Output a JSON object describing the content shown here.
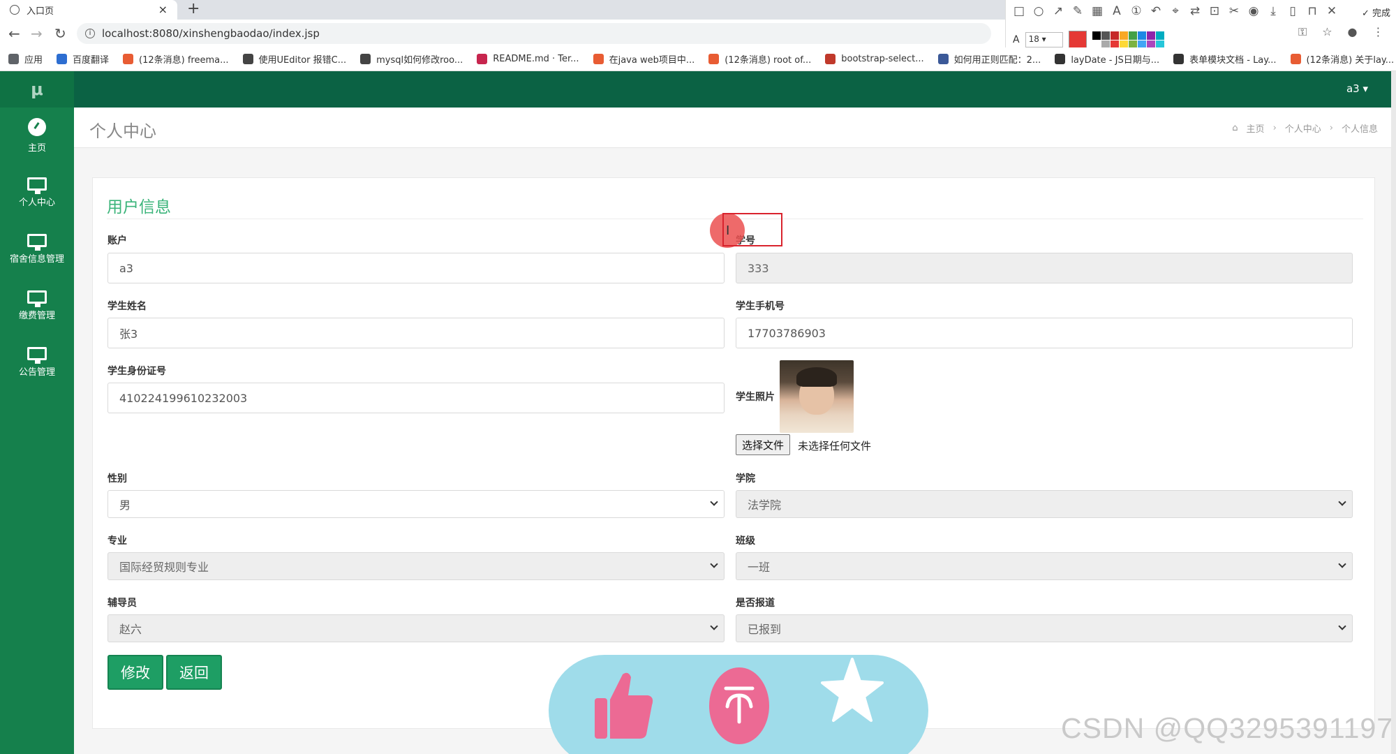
{
  "browser": {
    "tab_title": "入口页",
    "tab_close": "×",
    "new_tab": "+",
    "url": "localhost:8080/xinshengbaodao/index.jsp",
    "bookmarks": [
      {
        "label": "应用",
        "color": "#5f6368",
        "icon": "apps-icon"
      },
      {
        "label": "百度翻译",
        "color": "#2d6ed1",
        "icon": "translate-icon"
      },
      {
        "label": "(12条消息) freema...",
        "color": "#e85c33",
        "icon": "csdn-icon"
      },
      {
        "label": "使用UEditor 报错C...",
        "color": "#444444",
        "icon": "cnblogs-icon"
      },
      {
        "label": "mysql如何修改roo...",
        "color": "#444444",
        "icon": "cnblogs-icon"
      },
      {
        "label": "README.md · Ter...",
        "color": "#c7254e",
        "icon": "gitee-icon"
      },
      {
        "label": "在java web项目中...",
        "color": "#e85c33",
        "icon": "csdn-icon"
      },
      {
        "label": "(12条消息) root of...",
        "color": "#e85c33",
        "icon": "csdn-icon"
      },
      {
        "label": "bootstrap-select...",
        "color": "#c0392b",
        "icon": "page-icon"
      },
      {
        "label": "如何用正则匹配：2...",
        "color": "#3b5998",
        "icon": "baidu-icon"
      },
      {
        "label": "layDate - JS日期与...",
        "color": "#333333",
        "icon": "layui-icon"
      },
      {
        "label": "表单模块文档 - Lay...",
        "color": "#333333",
        "icon": "layui-icon"
      },
      {
        "label": "(12条消息) 关于lay...",
        "color": "#e85c33",
        "icon": "csdn-icon"
      }
    ],
    "annot_done": "完成",
    "annot_font_size": "18",
    "annot_current_color": "#e53935",
    "annot_palette": [
      "#000000",
      "#555555",
      "#c62828",
      "#f9a825",
      "#43a047",
      "#1e88e5",
      "#8e24aa",
      "#00acc1",
      "#ffffff",
      "#aaaaaa",
      "#e53935",
      "#fdd835",
      "#7cb342",
      "#42a5f5",
      "#ab47bc",
      "#26c6da"
    ]
  },
  "app": {
    "logo": "μ",
    "user": "a3 ▾",
    "nav": [
      {
        "label": "主页",
        "icon": "dashboard-icon"
      },
      {
        "label": "个人中心",
        "icon": "monitor-icon"
      },
      {
        "label": "宿舍信息管理",
        "icon": "monitor-icon"
      },
      {
        "label": "缴费管理",
        "icon": "monitor-icon"
      },
      {
        "label": "公告管理",
        "icon": "monitor-icon"
      }
    ],
    "page_title": "个人中心",
    "breadcrumb": {
      "home": "主页",
      "sep": "›",
      "level1": "个人中心",
      "level2": "个人信息"
    },
    "panel_title": "用户信息",
    "form": {
      "account_label": "账户",
      "account_value": "a3",
      "student_no_label": "学号",
      "student_no_value": "333",
      "name_label": "学生姓名",
      "name_value": "张3",
      "phone_label": "学生手机号",
      "phone_value": "17703786903",
      "id_label": "学生身份证号",
      "id_value": "410224199610232003",
      "photo_label": "学生照片",
      "file_button": "选择文件",
      "file_status": "未选择任何文件",
      "gender_label": "性别",
      "gender_value": "男",
      "college_label": "学院",
      "college_value": "法学院",
      "major_label": "专业",
      "major_value": "国际经贸规则专业",
      "class_label": "班级",
      "class_value": "一班",
      "counselor_label": "辅导员",
      "counselor_value": "赵六",
      "report_label": "是否报道",
      "report_value": "已报到"
    },
    "buttons": {
      "modify": "修改",
      "back": "返回"
    }
  },
  "overlay": {
    "watermark": "CSDN @QQ3295391197"
  }
}
